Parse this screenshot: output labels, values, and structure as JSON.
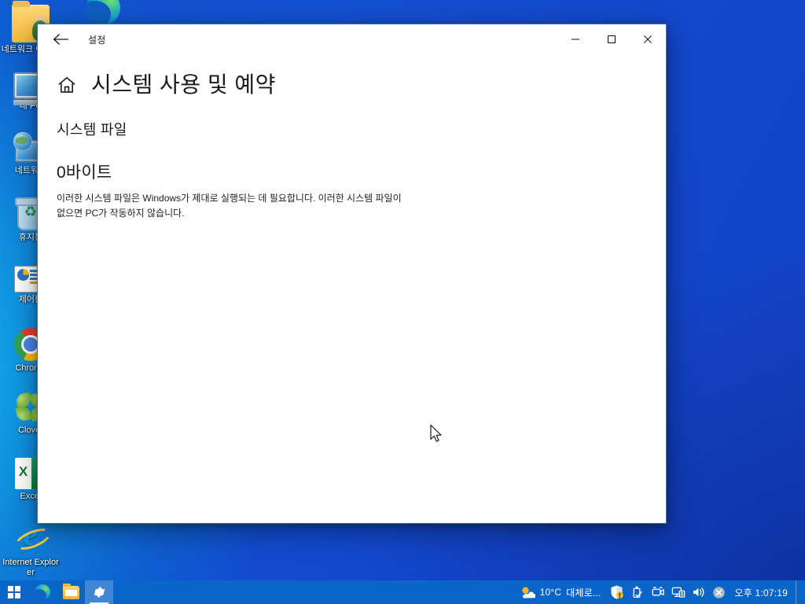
{
  "desktop": {
    "icons": [
      {
        "name": "network-share-folder",
        "label": "네트워크 이화…",
        "type": "folder"
      },
      {
        "name": "this-pc",
        "label": "내 PC",
        "type": "pc"
      },
      {
        "name": "network",
        "label": "네트워크",
        "type": "net"
      },
      {
        "name": "recycle-bin",
        "label": "휴지통",
        "type": "bin"
      },
      {
        "name": "control-panel",
        "label": "제어판",
        "type": "ctrl"
      },
      {
        "name": "chrome",
        "label": "Chrome",
        "type": "chrome"
      },
      {
        "name": "clover",
        "label": "Clover",
        "type": "clover"
      },
      {
        "name": "excel",
        "label": "Excel",
        "type": "excel"
      },
      {
        "name": "internet-explorer",
        "label": "Internet Explorer",
        "type": "ie"
      },
      {
        "name": "microsoft-edge",
        "label": "",
        "type": "edge"
      }
    ]
  },
  "window": {
    "app_title": "설정",
    "back_label": "←",
    "controls": {
      "minimize": "—",
      "maximize": "▢",
      "close": "✕"
    },
    "page_title": "시스템 사용 및 예약",
    "home_icon": "home-icon",
    "section": {
      "heading": "시스템 파일",
      "value": "0바이트",
      "description": "이러한 시스템 파일은 Windows가 제대로 실행되는 데 필요합니다. 이러한 시스템 파일이 없으면 PC가 작동하지 않습니다."
    }
  },
  "taskbar": {
    "buttons": [
      {
        "name": "start-button",
        "label": "시작",
        "active": false
      },
      {
        "name": "edge-taskbar",
        "label": "Microsoft Edge",
        "active": false
      },
      {
        "name": "file-explorer",
        "label": "파일 탐색기",
        "active": false
      },
      {
        "name": "settings-taskbar",
        "label": "설정",
        "active": true
      }
    ],
    "weather": {
      "temperature": "10°C",
      "condition": "대체로..."
    },
    "tray_icons": [
      {
        "name": "windows-security-icon",
        "label": "Windows 보안"
      },
      {
        "name": "safely-remove-hardware-icon",
        "label": "하드웨어 안전하게 제거"
      },
      {
        "name": "camera-icon",
        "label": "카메라"
      },
      {
        "name": "network-icon",
        "label": "네트워크"
      },
      {
        "name": "volume-icon",
        "label": "볼륨"
      },
      {
        "name": "action-center-error-icon",
        "label": "알림"
      }
    ],
    "clock": "오후 1:07:19"
  },
  "colors": {
    "accent": "#0b64c8",
    "window_border": "#2b6fd0",
    "text": "#1a1a1a",
    "taskbar": "#0b64c8"
  }
}
